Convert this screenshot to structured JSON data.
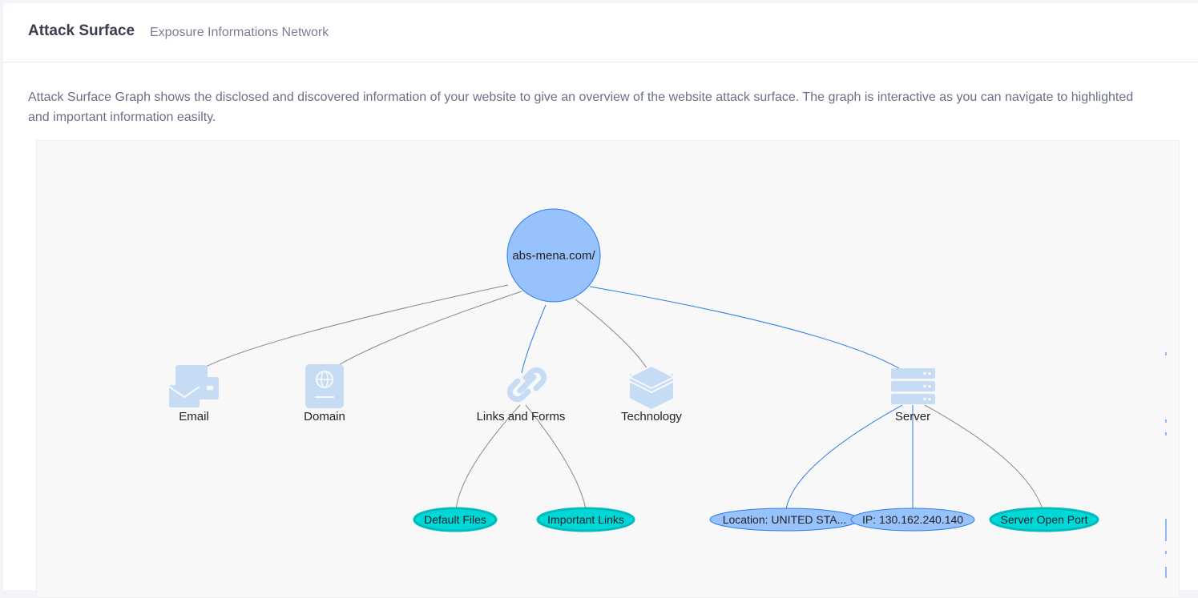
{
  "header": {
    "title": "Attack Surface",
    "subtitle": "Exposure Informations Network"
  },
  "description": "Attack Surface Graph shows the disclosed and discovered information of your website to give an overview of the website attack surface. The graph is interactive as you can navigate to highlighted and important information easilty.",
  "graph": {
    "root": {
      "label": "abs-mena.com/"
    },
    "categories": [
      {
        "label": "Email",
        "icon": "email-icon"
      },
      {
        "label": "Domain",
        "icon": "domain-icon"
      },
      {
        "label": "Links and Forms",
        "icon": "link-icon"
      },
      {
        "label": "Technology",
        "icon": "layers-icon"
      },
      {
        "label": "Server",
        "icon": "server-icon"
      }
    ],
    "leaves": [
      {
        "label": "Default Files",
        "parent": "Links and Forms",
        "highlight": true
      },
      {
        "label": "Important Links",
        "parent": "Links and Forms",
        "highlight": true
      },
      {
        "label": "Location: UNITED STA...",
        "parent": "Server",
        "highlight": false
      },
      {
        "label": "IP: 130.162.240.140",
        "parent": "Server",
        "highlight": false
      },
      {
        "label": "Server Open Port",
        "parent": "Server",
        "highlight": true
      }
    ],
    "colors": {
      "root_fill": "#97c2fc",
      "root_border": "#2b7ce9",
      "icon": "#c6dcf5",
      "edge_gray": "#888888",
      "edge_blue": "#2b7ce9",
      "highlight_fill": "#00d8d8",
      "highlight_border": "#00bcbc",
      "info_fill": "#97c2fc"
    }
  }
}
